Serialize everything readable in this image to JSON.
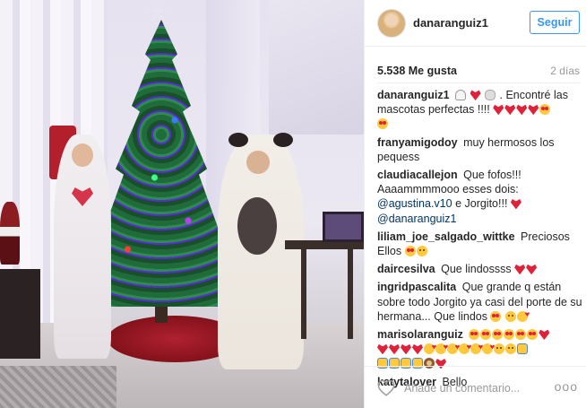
{
  "post": {
    "username": "danaranguiz1",
    "follow_label": "Seguir",
    "likes": "5.538 Me gusta",
    "time_ago": "2 días"
  },
  "comments": [
    {
      "user": "danaranguiz1",
      "text": ". Encontré las mascotas perfectas !!!!"
    },
    {
      "user": "franyamigodoy",
      "text": "muy hermosos los pequess"
    },
    {
      "user": "claudiacallejon",
      "text": "Que fofos!!! Aaaammmmooo esses dois:",
      "mention1": "@agustina.v10",
      "mid": "e Jorgito!!!",
      "mention2": "@danaranguiz1"
    },
    {
      "user": "liliam_joe_salgado_wittke",
      "text": "Preciosos Ellos"
    },
    {
      "user": "daircesilva",
      "text": "Que lindossss"
    },
    {
      "user": "ingridpascalita",
      "text": "Que grande q están sobre todo Jorgito ya casi del porte de su hermana... Que lindos"
    },
    {
      "user": "marisolaranguiz",
      "text": ""
    },
    {
      "user": "katytalover",
      "text": "Bello"
    }
  ],
  "footer": {
    "comment_placeholder": "Añade un comentario...",
    "more_label": "ooo"
  },
  "icons": {
    "like": "heart-outline-icon",
    "more": "more-options-icon",
    "accent": "#3897f0"
  }
}
